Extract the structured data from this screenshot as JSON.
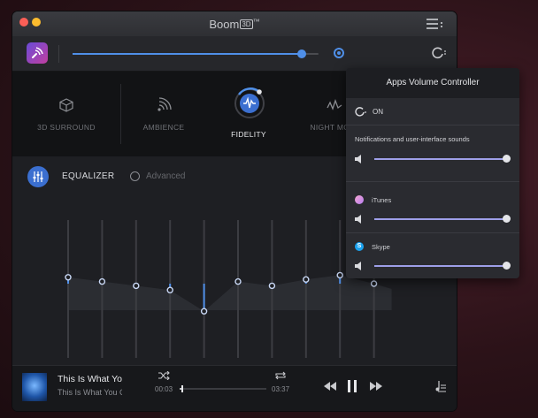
{
  "window": {
    "title": "Boom",
    "title_badge": "3D",
    "title_tm": "™"
  },
  "volume": {
    "level": 0.93
  },
  "effects": [
    {
      "label": "3D SURROUND",
      "active": false
    },
    {
      "label": "AMBIENCE",
      "active": false
    },
    {
      "label": "FIDELITY",
      "active": true
    },
    {
      "label": "NIGHT MODE",
      "active": false
    }
  ],
  "equalizer": {
    "label": "EQUALIZER",
    "advanced_label": "Advanced",
    "advanced_checked": false,
    "band_levels": [
      0.3,
      0.1,
      -0.1,
      -0.3,
      -1.3,
      0.1,
      -0.1,
      0.2,
      0.4,
      0.0
    ]
  },
  "player": {
    "track_title": "This Is What You Came For",
    "track_artist": "This Is What You Came For",
    "time_elapsed": "00:03",
    "time_total": "03:37",
    "progress": 0.02
  },
  "apps_panel": {
    "title": "Apps Volume Controller",
    "toggle_label": "ON",
    "notifications_label": "Notifications and user-interface sounds",
    "notifications_level": 1.0,
    "apps": [
      {
        "name": "iTunes",
        "level": 1.0
      },
      {
        "name": "Skype",
        "level": 1.0
      }
    ]
  },
  "colors": {
    "accent": "#4f8fe8",
    "panel_slider": "#9e9fe8",
    "eq_button": "#3b6fd0"
  }
}
